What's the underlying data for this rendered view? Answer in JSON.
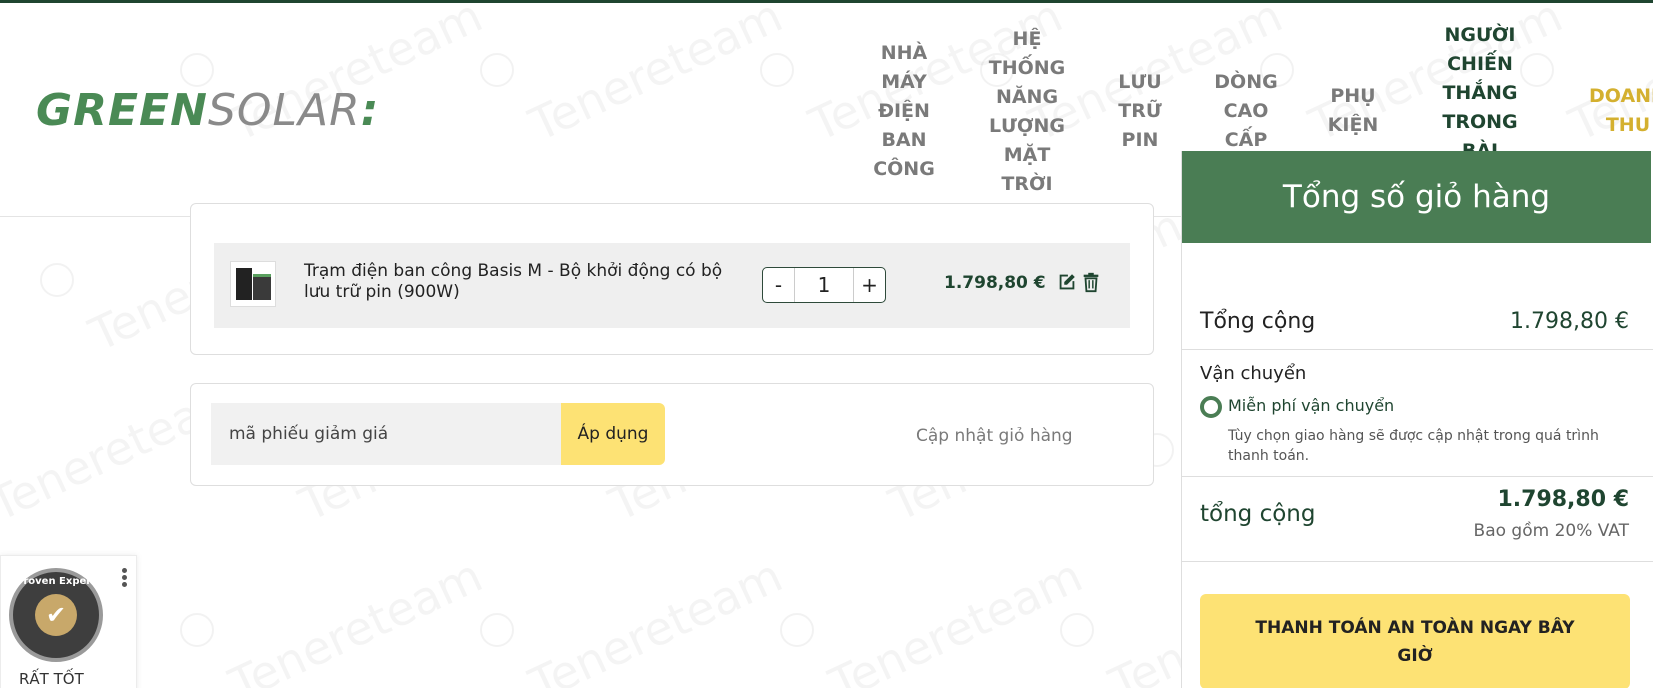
{
  "header": {
    "logo": {
      "part1": "GREEN",
      "part2": "SOLAR",
      "mark": ":"
    },
    "nav": [
      {
        "label": "NHÀ MÁY ĐIỆN BAN CÔNG"
      },
      {
        "label": "HỆ THỐNG NĂNG LƯỢNG MẶT TRỜI"
      },
      {
        "label": "LƯU TRỮ PIN"
      },
      {
        "label": "DÒNG CAO CẤP"
      },
      {
        "label": "PHỤ KIỆN"
      },
      {
        "label": "NGƯỜI CHIẾN THẮNG TRONG BÀI KIỂM"
      },
      {
        "label": "DOANH THU"
      }
    ]
  },
  "cart": {
    "item": {
      "name": "Trạm điện ban công Basis M - Bộ khởi động có bộ lưu trữ pin (900W)",
      "quantity": "1",
      "minus": "-",
      "plus": "+",
      "price": "1.798,80 €"
    },
    "coupon": {
      "placeholder": "mã phiếu giảm giá",
      "apply_label": "Áp dụng",
      "update_label": "Cập nhật giỏ hàng"
    }
  },
  "totals": {
    "title": "Tổng số giỏ hàng",
    "subtotal_label": "Tổng cộng",
    "subtotal_value": "1.798,80  €",
    "shipping_label": "Vận chuyển",
    "shipping_option": "Miễn phí vận chuyển",
    "shipping_note": "Tùy chọn giao hàng sẽ được cập nhật trong quá trình thanh toán.",
    "total_label": "tổng cộng",
    "total_value": "1.798,80  €",
    "vat_note": "Bao gồm 20% VAT",
    "checkout_label": "THANH TOÁN AN TOÀN NGAY BÂY GIỜ"
  },
  "widget": {
    "seal_text": "Proven Expert",
    "rating": "RẤT TỐT"
  },
  "watermark": "Tenereteam",
  "colors": {
    "brand_green": "#4a7d54",
    "dark_green": "#1f4530",
    "yellow": "#fde274",
    "gold": "#d4b02f"
  }
}
